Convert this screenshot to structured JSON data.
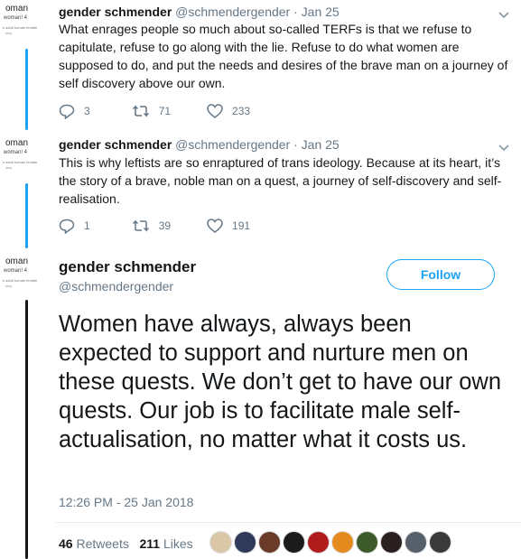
{
  "tweets": [
    {
      "avatar_lines": [
        "oman",
        "woman! 4",
        "'n adult human female",
        "lady"
      ],
      "name": "gender schmender",
      "handle": "@schmendergender",
      "sep": "·",
      "date": "Jan 25",
      "text": "What enrages people so much about so-called TERFs is that we refuse to capitulate, refuse to go along with the lie. Refuse to do what women are supposed to do, and put the needs and desires of the brave man on a journey of self discovery above our own.",
      "replies": "3",
      "retweets": "71",
      "likes": "233"
    },
    {
      "avatar_lines": [
        "oman",
        "woman! 4",
        "'n adult human female",
        "lady"
      ],
      "name": "gender schmender",
      "handle": "@schmendergender",
      "sep": "·",
      "date": "Jan 25",
      "text": "This is why leftists are so enraptured of trans ideology. Because at its heart, it’s the story of a brave, noble man on a quest, a journey of self-discovery and self-realisation.",
      "replies": "1",
      "retweets": "39",
      "likes": "191"
    }
  ],
  "main_tweet": {
    "avatar_lines": [
      "oman",
      "woman! 4",
      "'n adult human female",
      "lady"
    ],
    "name": "gender schmender",
    "handle": "@schmendergender",
    "follow_label": "Follow",
    "text": "Women have always, always been expected to support and nurture men on these quests. We don’t get to have our own quests. Our job is to facilitate male self-actualisation, no matter what it costs us.",
    "timestamp": "12:26 PM - 25 Jan 2018",
    "retweet_count": "46",
    "retweet_label": "Retweets",
    "like_count": "211",
    "like_label": "Likes",
    "liker_colors": [
      "#d9c7a8",
      "#2f3a5a",
      "#6b3b2a",
      "#1b1b1b",
      "#b01c1c",
      "#e58a1e",
      "#3d5b2a",
      "#2a2020",
      "#55606b",
      "#3a3a3a"
    ]
  },
  "colors": {
    "accent": "#1da1f2",
    "text": "#14171a",
    "muted": "#657786",
    "divider": "#e6ecf0"
  },
  "icons": [
    "reply-icon",
    "retweet-icon",
    "like-icon",
    "chevron-down-icon"
  ]
}
